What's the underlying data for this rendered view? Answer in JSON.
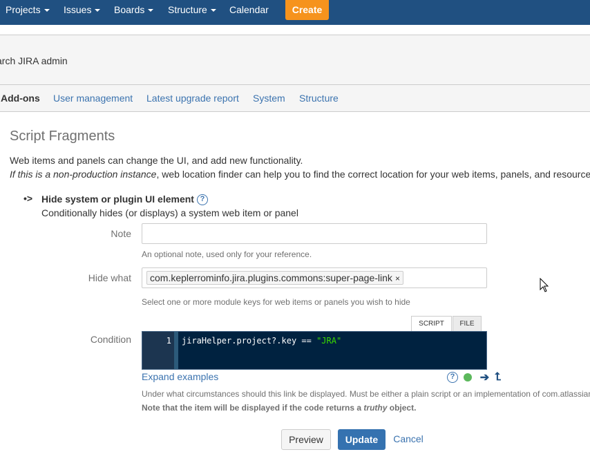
{
  "topnav": {
    "items": [
      "Projects",
      "Issues",
      "Boards",
      "Structure",
      "Calendar"
    ],
    "create_label": "Create"
  },
  "admin_header": {
    "search_text": "arch JIRA admin"
  },
  "tabs": [
    "Add-ons",
    "User management",
    "Latest upgrade report",
    "System",
    "Structure"
  ],
  "page": {
    "title": "Script Fragments",
    "intro_line1": "Web items and panels can change the UI, and add new functionality.",
    "intro_line2_italic": "If this is a non-production instance",
    "intro_line2_rest": ", web location finder can help you to find the correct location for your web items, panels, and resource"
  },
  "fragment": {
    "bullet": "•>",
    "title": "Hide system or plugin UI element",
    "help": "?",
    "description": "Conditionally hides (or displays) a system web item or panel"
  },
  "form": {
    "note_label": "Note",
    "note_value": "",
    "note_helper": "An optional note, used only for your reference.",
    "hide_label": "Hide what",
    "hide_token": "com.keplerrominfo.jira.plugins.commons:super-page-link",
    "hide_token_remove": "×",
    "hide_helper": "Select one or more module keys for web items or panels you wish to hide",
    "script_tab": "SCRIPT",
    "file_tab": "FILE",
    "condition_label": "Condition",
    "line_number": "1",
    "code_plain": "jiraHelper.project?.key == ",
    "code_string": "\"JRA\"",
    "expand_link": "Expand examples",
    "condition_helper": "Under what circumstances should this link be displayed. Must be either a plain script or an implementation of com.atlassian",
    "note_bold_1": "Note that the item will be displayed if the code returns a ",
    "note_bold_italic": "truthy",
    "note_bold_2": " object."
  },
  "icons": {
    "help": "question-circle-icon",
    "status": "green-dot-icon",
    "arrow_right": "arrow-right-icon",
    "arrow_up": "arrow-up-icon",
    "cursor": "mouse-pointer-icon"
  },
  "buttons": {
    "preview": "Preview",
    "update": "Update",
    "cancel": "Cancel"
  },
  "colors": {
    "nav_bg": "#205081",
    "create_bg": "#f6931d",
    "link": "#3b73af",
    "editor_bg": "#002240",
    "code_string": "#3ad900",
    "update_bg": "#3572b0"
  }
}
